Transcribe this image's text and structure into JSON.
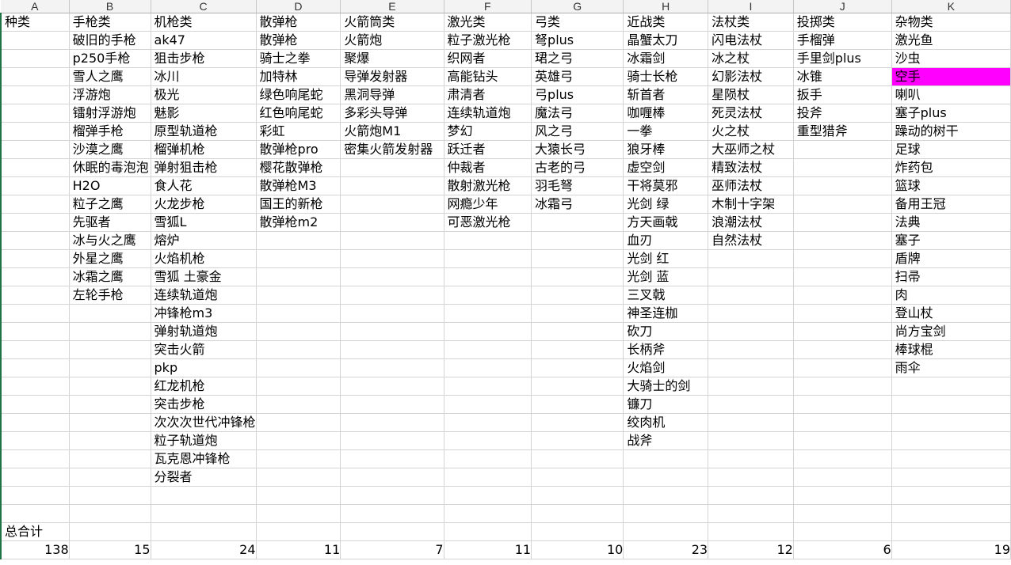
{
  "columns": [
    "A",
    "B",
    "C",
    "D",
    "E",
    "F",
    "G",
    "H",
    "I",
    "J",
    "K"
  ],
  "headers": [
    "种类",
    "手枪类",
    "机枪类",
    "散弹枪",
    "火箭筒类",
    "激光类",
    "弓类",
    "近战类",
    "法杖类",
    "投掷类",
    "杂物类"
  ],
  "cells": [
    [
      null,
      [
        "破旧的手枪",
        "black"
      ],
      [
        "ak47",
        "black"
      ],
      [
        "散弹枪",
        "black"
      ],
      [
        "火箭炮",
        "mag"
      ],
      [
        "粒子激光枪",
        "mag"
      ],
      [
        "弩plus",
        "cyan"
      ],
      [
        "晶蟹太刀",
        "red"
      ],
      [
        "闪电法杖",
        "cyan"
      ],
      [
        "手榴弹",
        "mag"
      ],
      [
        "激光鱼",
        "orange"
      ]
    ],
    [
      null,
      [
        "p250手枪",
        "black"
      ],
      [
        "狙击步枪",
        "black"
      ],
      [
        "骑士之拳",
        "cyan"
      ],
      [
        "聚爆",
        "orange"
      ],
      [
        "织网者",
        "cyan"
      ],
      [
        "珺之弓",
        "cyan"
      ],
      [
        "冰霜剑",
        "cyan"
      ],
      [
        "冰之杖",
        "cyan"
      ],
      [
        "手里剑plus",
        "mag"
      ],
      [
        "沙虫",
        "red"
      ]
    ],
    [
      null,
      [
        "雪人之鹰",
        "red"
      ],
      [
        "冰川",
        "cyan"
      ],
      [
        "加特林",
        "mag"
      ],
      [
        "导弹发射器",
        "orange"
      ],
      [
        "高能钻头",
        "mag"
      ],
      [
        "英雄弓",
        "mag"
      ],
      [
        "骑士长枪",
        "green"
      ],
      [
        "幻影法杖",
        "orange"
      ],
      [
        "冰锥",
        "cyan"
      ],
      [
        "空手",
        "fillmag"
      ]
    ],
    [
      null,
      [
        "浮游炮",
        "red"
      ],
      [
        "极光",
        "mag"
      ],
      [
        "绿色响尾蛇",
        "cyan"
      ],
      [
        "黑洞导弹",
        "mag"
      ],
      [
        "肃清者",
        "mag"
      ],
      [
        "弓plus",
        "cyan"
      ],
      [
        "斩首者",
        "green"
      ],
      [
        "星陨杖",
        "red"
      ],
      [
        "扳手",
        "green"
      ],
      [
        "喇叭",
        "green"
      ]
    ],
    [
      null,
      [
        "镭射浮游炮",
        "red"
      ],
      [
        "魅影",
        "orange"
      ],
      [
        "红色响尾蛇",
        "cyan"
      ],
      [
        "多彩头导弹",
        "cyan"
      ],
      [
        "连续轨道炮",
        "mag"
      ],
      [
        "魔法弓",
        "orange"
      ],
      [
        "咖喱棒",
        "red"
      ],
      [
        "死灵法杖",
        "red"
      ],
      [
        "投斧",
        "black"
      ],
      [
        "塞子plus",
        "mag"
      ]
    ],
    [
      null,
      [
        "榴弹手枪",
        "green"
      ],
      [
        "原型轨道枪",
        "cyan"
      ],
      [
        "彩虹",
        "mag"
      ],
      [
        "火箭炮M1",
        "orange"
      ],
      [
        "梦幻",
        "orange"
      ],
      [
        "风之弓",
        "cyan"
      ],
      [
        "一拳",
        "red"
      ],
      [
        "火之杖",
        "cyan"
      ],
      [
        "重型猎斧",
        "cyan"
      ],
      [
        "躁动的树干",
        "red"
      ]
    ],
    [
      null,
      [
        "沙漠之鹰",
        "black"
      ],
      [
        "榴弹机枪",
        "orange"
      ],
      [
        "散弹枪pro",
        "black"
      ],
      [
        "密集火箭发射器",
        "black"
      ],
      [
        "跃迁者",
        "cyan"
      ],
      [
        "大猿长弓",
        "red"
      ],
      [
        "狼牙棒",
        "green"
      ],
      [
        "大巫师之杖",
        "red"
      ],
      null,
      [
        "足球",
        "black"
      ]
    ],
    [
      null,
      [
        "休眠的毒泡泡",
        "black"
      ],
      [
        "弹射狙击枪",
        "mag"
      ],
      [
        "樱花散弹枪",
        "cyan"
      ],
      null,
      [
        "仲裁者",
        "green"
      ],
      [
        "古老的弓",
        "black"
      ],
      [
        "虚空剑",
        "cyan"
      ],
      [
        "精致法杖",
        "orange"
      ],
      null,
      [
        "炸药包",
        "black"
      ]
    ],
    [
      null,
      [
        "H2O",
        "black"
      ],
      [
        "食人花",
        "red"
      ],
      [
        "散弹枪M3",
        "cyan"
      ],
      null,
      [
        "散射激光枪",
        "mag"
      ],
      [
        "羽毛弩",
        "green"
      ],
      [
        "干将莫邪",
        "black"
      ],
      [
        "巫师法杖",
        "cyan"
      ],
      null,
      [
        "篮球",
        "black"
      ]
    ],
    [
      null,
      [
        "粒子之鹰",
        "green"
      ],
      [
        "火龙步枪",
        "red"
      ],
      [
        "国王的新枪",
        "red"
      ],
      null,
      [
        "网瘾少年",
        "cyan"
      ],
      [
        "冰霜弓",
        "cyan"
      ],
      [
        "光剑 绿",
        "cyan"
      ],
      [
        "木制十字架",
        "black"
      ],
      null,
      [
        "备用王冠",
        "red"
      ]
    ],
    [
      null,
      [
        "先驱者",
        "black"
      ],
      [
        "雪狐L",
        "black"
      ],
      [
        "散弹枪m2",
        "green"
      ],
      null,
      [
        "可恶激光枪",
        "cyan"
      ],
      null,
      [
        "方天画戟",
        "green"
      ],
      [
        "浪潮法杖",
        "black"
      ],
      null,
      [
        "法典",
        "black"
      ]
    ],
    [
      null,
      [
        "冰与火之鹰",
        "cyan"
      ],
      [
        "熔炉",
        "cyan"
      ],
      null,
      null,
      null,
      null,
      [
        "血刃",
        "black"
      ],
      [
        "自然法杖",
        "black"
      ],
      null,
      [
        "塞子",
        "cyan"
      ]
    ],
    [
      null,
      [
        "外星之鹰",
        "green"
      ],
      [
        "火焰机枪",
        "green"
      ],
      null,
      null,
      null,
      null,
      [
        "光剑 红",
        "cyan"
      ],
      null,
      null,
      [
        "盾牌",
        "red"
      ]
    ],
    [
      null,
      [
        "冰霜之鹰",
        "green"
      ],
      [
        "雪狐 土豪金",
        "orange"
      ],
      null,
      null,
      null,
      null,
      [
        "光剑 蓝",
        "cyan"
      ],
      null,
      null,
      [
        "扫帚",
        "green"
      ]
    ],
    [
      null,
      [
        "左轮手枪",
        "black"
      ],
      [
        "连续轨道炮",
        "mag"
      ],
      null,
      null,
      null,
      null,
      [
        "三叉戟",
        "cyan"
      ],
      null,
      null,
      [
        "肉",
        "green"
      ]
    ],
    [
      null,
      null,
      [
        "冲锋枪m3",
        "green"
      ],
      null,
      null,
      null,
      null,
      [
        "神圣连枷",
        "black"
      ],
      null,
      null,
      [
        "登山杖",
        "black"
      ]
    ],
    [
      null,
      null,
      [
        "弹射轨道炮",
        "cyan"
      ],
      null,
      null,
      null,
      null,
      [
        "砍刀",
        "black"
      ],
      null,
      null,
      [
        "尚方宝剑",
        "green"
      ]
    ],
    [
      null,
      null,
      [
        "突击火箭",
        "cyan"
      ],
      null,
      null,
      null,
      null,
      [
        "长柄斧",
        "black"
      ],
      null,
      null,
      [
        "棒球棍",
        "cyan"
      ]
    ],
    [
      null,
      null,
      [
        "pkp",
        "cyan"
      ],
      null,
      null,
      null,
      null,
      [
        "火焰剑",
        "mag"
      ],
      null,
      null,
      [
        "雨伞",
        "black"
      ]
    ],
    [
      null,
      null,
      [
        "红龙机枪",
        "black"
      ],
      null,
      null,
      null,
      null,
      [
        "大骑士的剑",
        "red"
      ],
      null,
      null,
      null
    ],
    [
      null,
      null,
      [
        "突击步枪",
        "black"
      ],
      null,
      null,
      null,
      null,
      [
        "镰刀",
        "black"
      ],
      null,
      null,
      null
    ],
    [
      null,
      null,
      [
        "次次次世代冲锋枪",
        "mag"
      ],
      null,
      null,
      null,
      null,
      [
        "绞肉机",
        "mag"
      ],
      null,
      null,
      null
    ],
    [
      null,
      null,
      [
        "粒子轨道炮",
        "black"
      ],
      null,
      null,
      null,
      null,
      [
        "战斧",
        "black"
      ],
      null,
      null,
      null
    ],
    [
      null,
      null,
      [
        "瓦克恩冲锋枪",
        "red"
      ],
      null,
      null,
      null,
      null,
      null,
      null,
      null,
      null
    ],
    [
      null,
      null,
      [
        "分裂者",
        "black"
      ],
      null,
      null,
      null,
      null,
      null,
      null,
      null,
      null
    ]
  ],
  "total_label": "总合计",
  "totals": [
    "138",
    "15",
    "24",
    "11",
    "7",
    "11",
    "10",
    "23",
    "12",
    "6",
    "19"
  ],
  "colors": {
    "red": "#ff0000",
    "cyan": "#1ea0d8",
    "magenta": "#e21ee6",
    "orange": "#f0a018",
    "green": "#8cc448",
    "fill_magenta": "#ff00ff"
  }
}
